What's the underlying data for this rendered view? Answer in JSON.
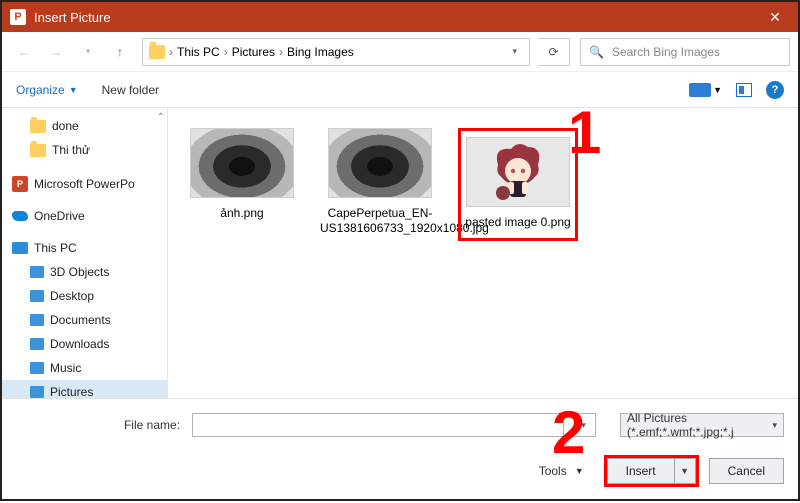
{
  "title": "Insert Picture",
  "app_badge": "P",
  "breadcrumb": {
    "items": [
      "This PC",
      "Pictures",
      "Bing Images"
    ]
  },
  "search": {
    "placeholder": "Search Bing Images"
  },
  "toolbar": {
    "organize": "Organize",
    "new_folder": "New folder"
  },
  "tree": {
    "folders": [
      "done",
      "Thi thử"
    ],
    "powerpoint": "Microsoft PowerPo",
    "onedrive": "OneDrive",
    "thispc": "This PC",
    "devices": [
      "3D Objects",
      "Desktop",
      "Documents",
      "Downloads",
      "Music",
      "Pictures"
    ]
  },
  "files": [
    {
      "name": "ảnh.png"
    },
    {
      "name": "CapePerpetua_EN-US1381606733_1920x1080.jpg"
    },
    {
      "name": "pasted image 0.png"
    }
  ],
  "footer": {
    "filename_label": "File name:",
    "filter": "All Pictures (*.emf;*.wmf;*.jpg;*.j",
    "tools": "Tools",
    "insert": "Insert",
    "cancel": "Cancel"
  },
  "annotations": {
    "one": "1",
    "two": "2"
  }
}
